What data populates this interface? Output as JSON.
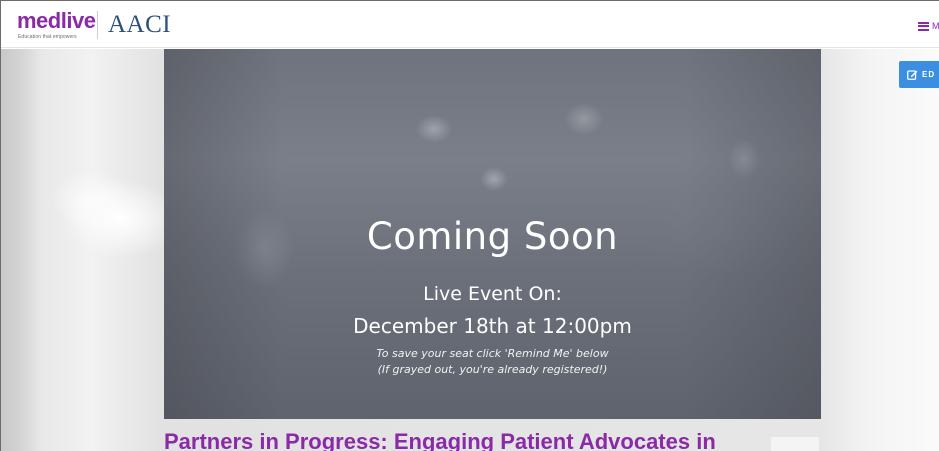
{
  "header": {
    "logo_text": "medlive",
    "tagline": "Education that empowers",
    "partner_logo": "AACI",
    "menu_label": "M",
    "menu_icon": "hamburger-icon"
  },
  "hero": {
    "title": "Coming Soon",
    "subtitle_line1": "Live Event On:",
    "subtitle_line2": "December 18th at 12:00pm",
    "note_line1": "To save your seat click 'Remind Me' below",
    "note_line2": "(If grayed out, you're already registered!)"
  },
  "edit_button": {
    "label": "ED",
    "icon": "edit-icon",
    "color": "#3c8fe0"
  },
  "event": {
    "title": "Partners in Progress: Engaging Patient Advocates in"
  },
  "colors": {
    "brand": "#8a2aa8",
    "brand_accent": "#e0892a",
    "aaci_blue": "#2c4f7c"
  }
}
